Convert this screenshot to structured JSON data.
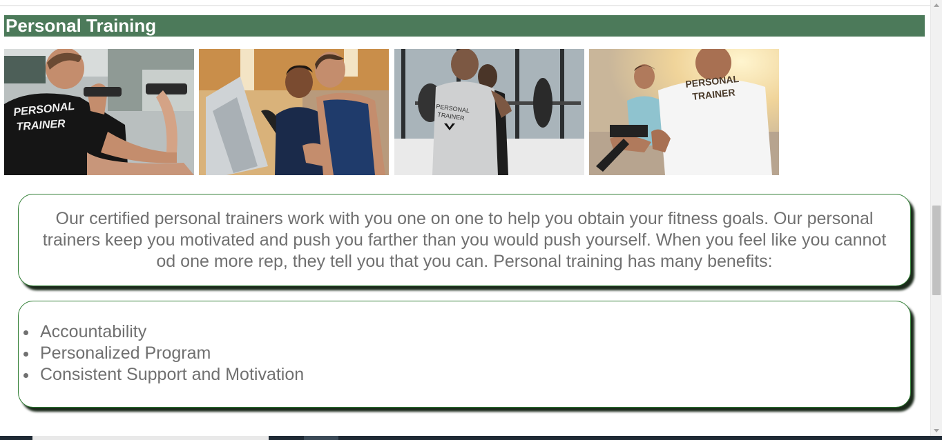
{
  "section": {
    "title": "Personal Training"
  },
  "gallery": {
    "photos": [
      {
        "shirt_text": [
          "PERSONAL",
          "TRAINER"
        ],
        "icon": "trainer-dumbbell-photo"
      },
      {
        "icon": "trainer-bike-photo"
      },
      {
        "shirt_text": [
          "PERSONAL",
          "TRAINER"
        ],
        "icon": "trainer-barbell-photo"
      },
      {
        "shirt_text": [
          "PERSONAL",
          "TRAINER"
        ],
        "icon": "trainer-machine-photo"
      }
    ]
  },
  "intro": {
    "text": "Our certified personal trainers work with you one on one to help you obtain your fitness goals. Our personal trainers keep you motivated and push you farther than you would push yourself. When you feel like you cannot od one more rep, they tell you that you can. Personal training has many benefits:"
  },
  "benefits": {
    "items": [
      "Accountability",
      "Personalized Program",
      "Consistent Support and Motivation"
    ]
  },
  "colors": {
    "header_bg": "#4c7a5a",
    "card_border": "#2e7d32",
    "body_text": "#707070"
  }
}
